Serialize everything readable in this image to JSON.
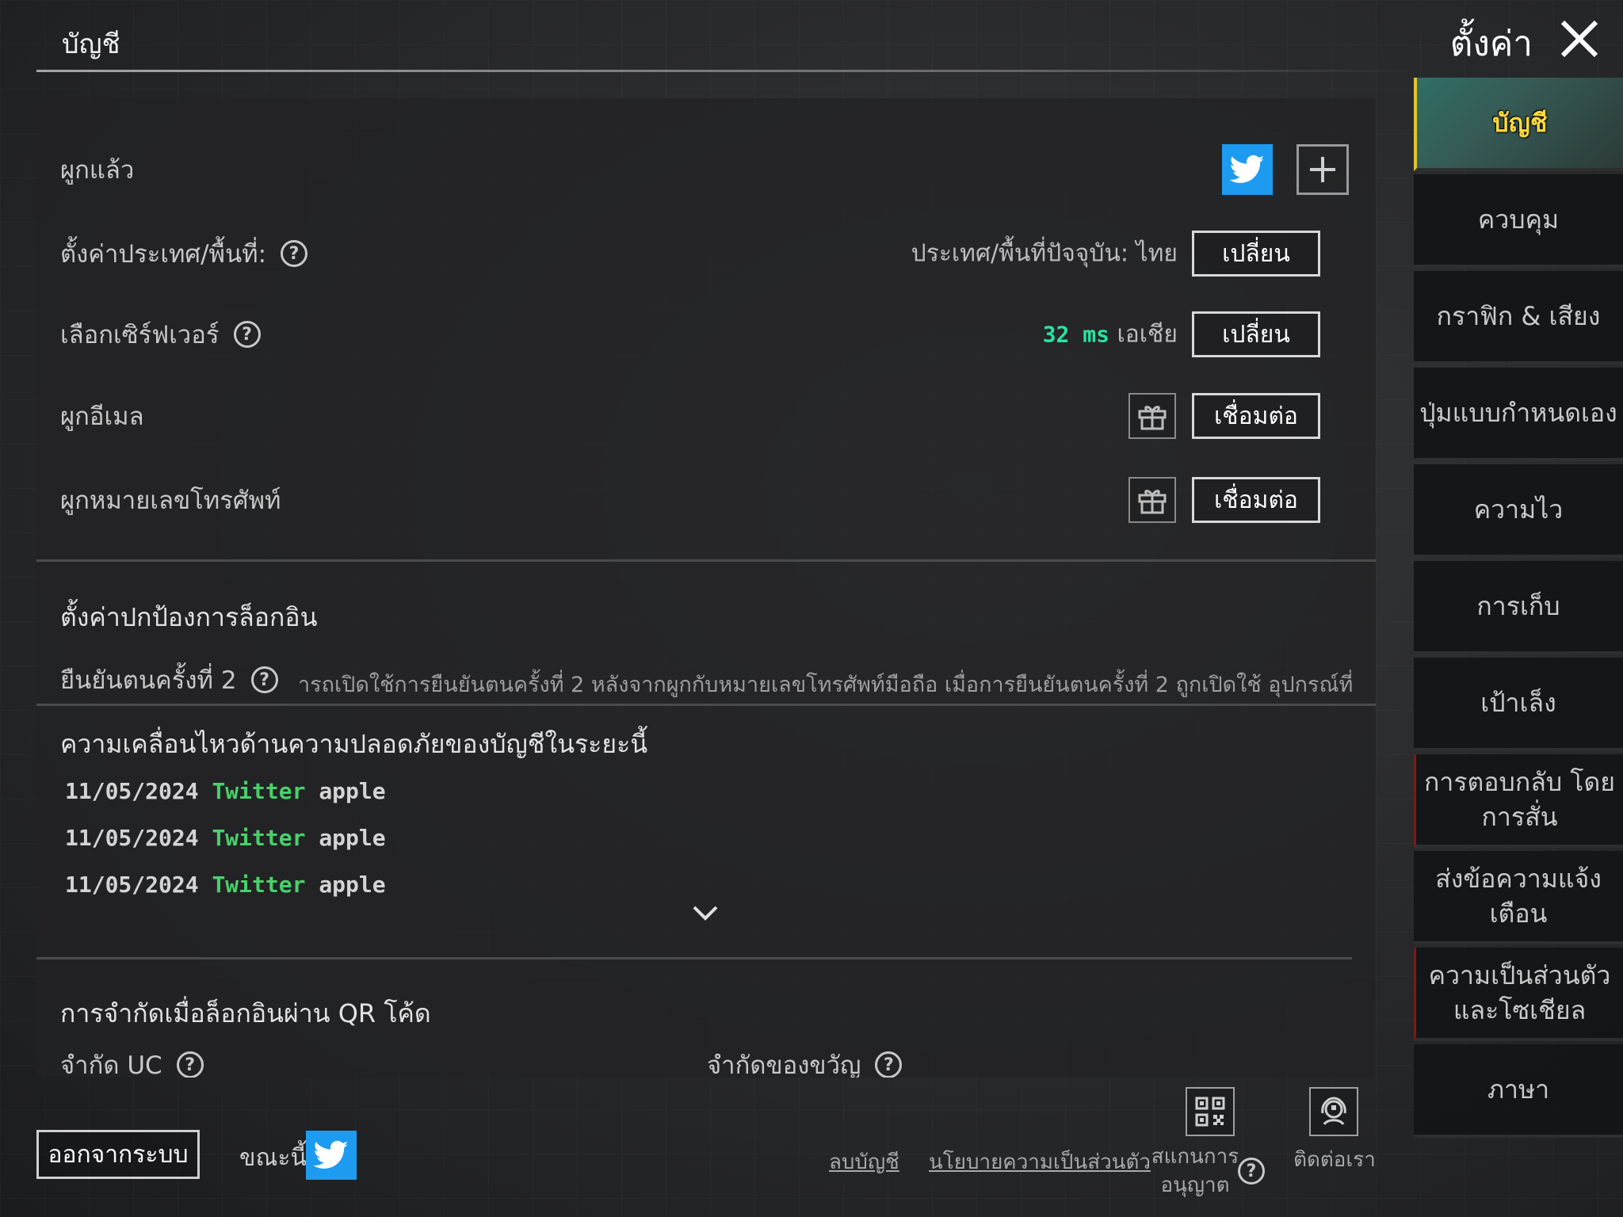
{
  "header": {
    "title": "บัญชี",
    "settings_title": "ตั้งค่า"
  },
  "account": {
    "bound_label": "ผูกแล้ว",
    "region": {
      "label": "ตั้งค่าประเทศ/พื้นที่:",
      "current": "ประเทศ/พื้นที่ปัจจุบัน: ไทย",
      "button": "เปลี่ยน"
    },
    "server": {
      "label": "เลือกเซิร์ฟเวอร์",
      "ping": "32 ms",
      "name": "เอเชีย",
      "button": "เปลี่ยน"
    },
    "email": {
      "label": "ผูกอีเมล",
      "button": "เชื่อมต่อ"
    },
    "phone": {
      "label": "ผูกหมายเลขโทรศัพท์",
      "button": "เชื่อมต่อ"
    }
  },
  "login_protection": {
    "title": "ตั้งค่าปกป้องการล็อกอิน",
    "two_factor_label": "ยืนยันตนครั้งที่ 2",
    "two_factor_desc": "ารถเปิดใช้การยืนยันตนครั้งที่ 2 หลังจากผูกกับหมายเลขโทรศัพท์มือถือ เมื่อการยืนยันตนครั้งที่ 2 ถูกเปิดใช้ อุปกรณ์ที่ไม่ได้รับการเ"
  },
  "activity": {
    "title": "ความเคลื่อนไหวด้านความปลอดภัยของบัญชีในระยะนี้",
    "entries": [
      {
        "date": "11/05/2024",
        "platform": "Twitter",
        "device": "apple"
      },
      {
        "date": "11/05/2024",
        "platform": "Twitter",
        "device": "apple"
      },
      {
        "date": "11/05/2024",
        "platform": "Twitter",
        "device": "apple"
      }
    ]
  },
  "qr_limits": {
    "title": "การจำกัดเมื่อล็อกอินผ่าน QR โค้ด",
    "uc_label": "จำกัด UC",
    "gift_label": "จำกัดของขวัญ"
  },
  "sidebar": {
    "items": [
      {
        "label": "บัญชี"
      },
      {
        "label": "ควบคุม"
      },
      {
        "label": "กราฟิก & เสียง"
      },
      {
        "label": "ปุ่มแบบกำหนดเอง"
      },
      {
        "label": "ความไว"
      },
      {
        "label": "การเก็บ"
      },
      {
        "label": "เป้าเล็ง"
      },
      {
        "label": "การตอบกลับ โดยการสั่น"
      },
      {
        "label": "ส่งข้อความแจ้งเตือน"
      },
      {
        "label": "ความเป็นส่วนตัว และโซเชียล"
      },
      {
        "label": "ภาษา"
      }
    ]
  },
  "footer": {
    "logout": "ออกจากระบบ",
    "current_label": "ขณะนี้",
    "delete_account": "ลบบัญชี",
    "privacy_policy": "นโยบายความเป็นส่วนตัว",
    "scan_auth_line1": "สแกนการ",
    "scan_auth_line2": "อนุญาต",
    "contact_us": "ติดต่อเรา"
  },
  "colors": {
    "twitter": "#1d9bf0",
    "ping": "#29e3a0",
    "platform": "#49d06a",
    "active_tab_text": "#ffd93d"
  },
  "icons": [
    "twitter-icon",
    "plus-icon",
    "help-icon",
    "gift-icon",
    "chevron-down-icon",
    "close-icon",
    "qr-code-icon",
    "support-icon"
  ]
}
